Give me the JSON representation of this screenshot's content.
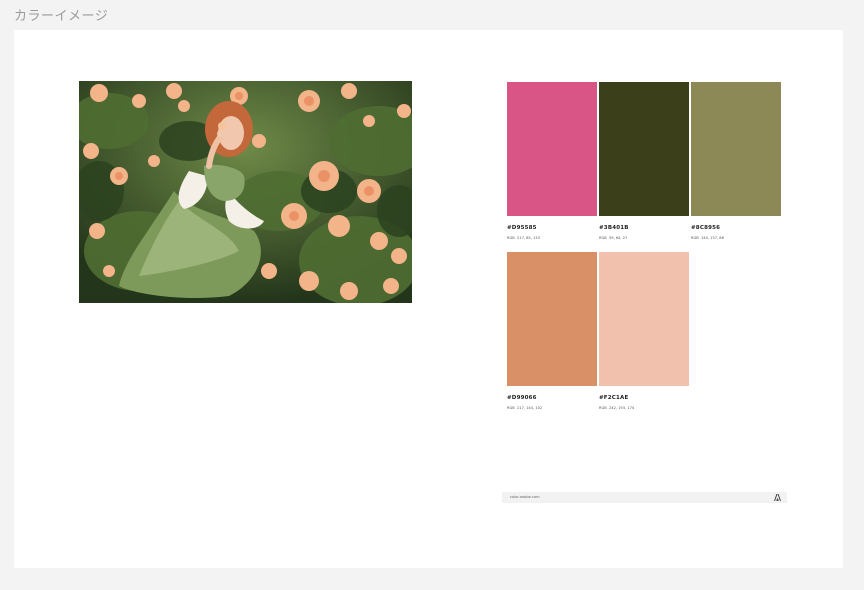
{
  "page": {
    "title": "カラーイメージ"
  },
  "swatches": [
    {
      "hex": "#D95585",
      "rgb_label": "RGB",
      "rgb": "217, 85, 133",
      "color": "#D95585"
    },
    {
      "hex": "#3B401B",
      "rgb_label": "RGB",
      "rgb": "59, 64, 27",
      "color": "#3B401B"
    },
    {
      "hex": "#8C8956",
      "rgb_label": "RGB",
      "rgb": "140, 137, 86",
      "color": "#8C8956"
    },
    {
      "hex": "#D99066",
      "rgb_label": "RGB",
      "rgb": "217, 144, 102",
      "color": "#D99066"
    },
    {
      "hex": "#F2C1AE",
      "rgb_label": "RGB",
      "rgb": "242, 193, 174",
      "color": "#F2C1AE"
    }
  ],
  "footer": {
    "site": "color.adobe.com",
    "logo_icon": "adobe-logo-icon"
  }
}
